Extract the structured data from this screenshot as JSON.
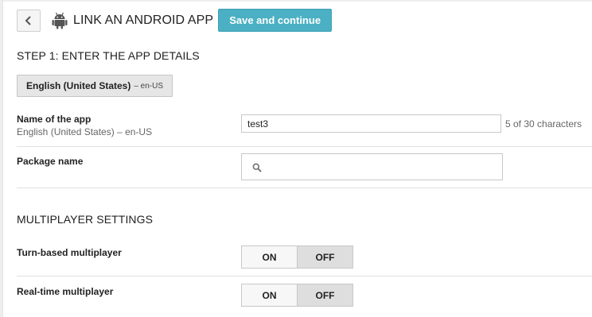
{
  "header": {
    "back_icon": "chevron-left-icon",
    "app_icon": "android-icon",
    "title": "LINK AN ANDROID APP",
    "save_label": "Save and continue",
    "save_color": "#4bb0c3"
  },
  "step1": {
    "title": "STEP 1: ENTER THE APP DETAILS",
    "language_tab": {
      "name": "English (United States)",
      "code": "– en-US"
    }
  },
  "app_name": {
    "label": "Name of the app",
    "sublabel": "English (United States) – en-US",
    "value": "test3",
    "char_count": "5 of 30 characters"
  },
  "package_name": {
    "label": "Package name",
    "value": "",
    "icon": "search-icon"
  },
  "multiplayer": {
    "title": "MULTIPLAYER SETTINGS",
    "turn_based": {
      "label": "Turn-based multiplayer",
      "on_label": "ON",
      "off_label": "OFF",
      "selected": "OFF"
    },
    "real_time": {
      "label": "Real-time multiplayer",
      "on_label": "ON",
      "off_label": "OFF",
      "selected": "OFF"
    }
  }
}
